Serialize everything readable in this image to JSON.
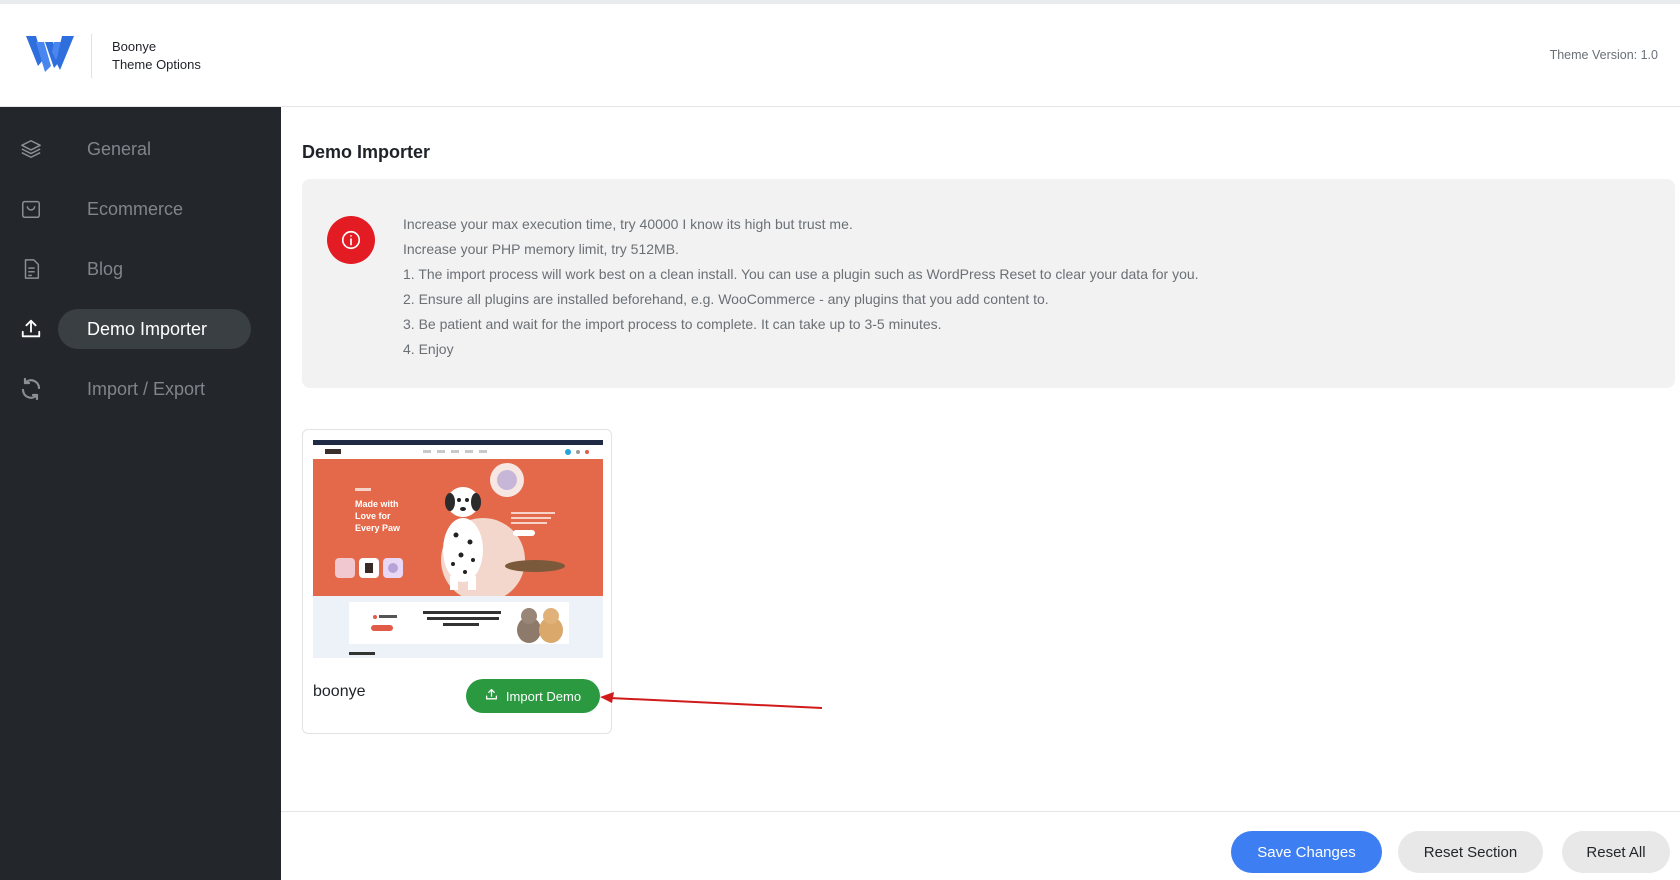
{
  "header": {
    "brand_line1": "Boonye",
    "brand_line2": "Theme Options",
    "theme_version": "Theme Version: 1.0"
  },
  "sidebar": {
    "items": [
      {
        "label": "General",
        "icon": "layers-icon"
      },
      {
        "label": "Ecommerce",
        "icon": "shopping-bag-icon"
      },
      {
        "label": "Blog",
        "icon": "document-icon"
      },
      {
        "label": "Demo Importer",
        "icon": "upload-icon",
        "active": true
      },
      {
        "label": "Import / Export",
        "icon": "refresh-icon"
      }
    ]
  },
  "main": {
    "title": "Demo Importer",
    "notice": {
      "icon": "info-icon",
      "lines": [
        "Increase your max execution time, try 40000 I know its high but trust me.",
        "Increase your PHP memory limit, try 512MB.",
        "1. The import process will work best on a clean install. You can use a plugin such as WordPress Reset to clear your data for you.",
        "2. Ensure all plugins are installed beforehand, e.g. WooCommerce - any plugins that you add content to.",
        "3. Be patient and wait for the import process to complete. It can take up to 3-5 minutes.",
        "4. Enjoy"
      ]
    },
    "demo": {
      "name": "boonye",
      "import_label": "Import Demo",
      "thumbnail": {
        "hero_heading": [
          "Made with",
          "Love for",
          "Every Paw"
        ]
      }
    }
  },
  "footer": {
    "save_label": "Save Changes",
    "reset_section_label": "Reset Section",
    "reset_all_label": "Reset All"
  },
  "colors": {
    "sidebar_bg": "#23272b",
    "accent_blue": "#3d7ff2",
    "import_green": "#2a9940",
    "notice_red": "#e31b23",
    "thumb_orange": "#e4694a"
  }
}
